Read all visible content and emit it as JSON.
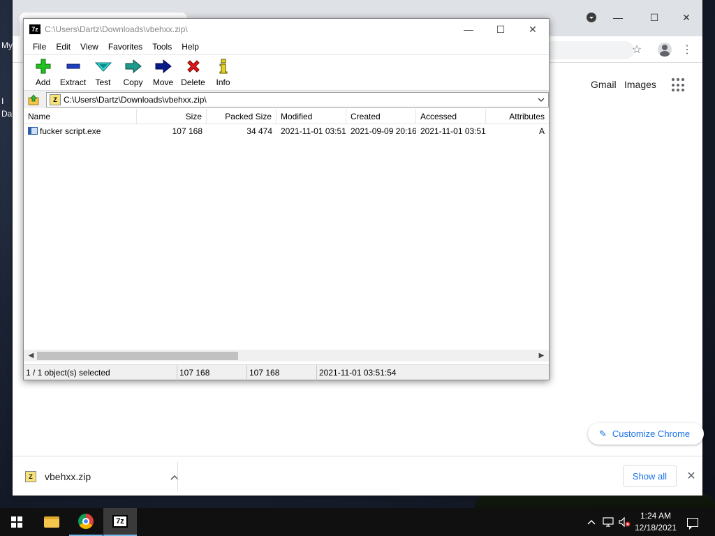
{
  "desktop": {
    "labels": [
      "My",
      "I",
      "Da"
    ]
  },
  "chrome": {
    "links": {
      "gmail": "Gmail",
      "images": "Images"
    },
    "customize_label": "Customize Chrome",
    "download": {
      "filename": "vbehxx.zip",
      "show_all": "Show all"
    },
    "icons": {
      "profile": "profile-avatar-icon",
      "bookmark": "star-icon",
      "menu": "kebab-menu-icon",
      "apps": "apps-grid-icon",
      "edit": "pencil-icon"
    }
  },
  "sevenzip": {
    "title": "C:\\Users\\Dartz\\Downloads\\vbehxx.zip\\",
    "app_icon_text": "7z",
    "menu": [
      "File",
      "Edit",
      "View",
      "Favorites",
      "Tools",
      "Help"
    ],
    "toolbar": [
      {
        "id": "add",
        "label": "Add",
        "icon": "plus-icon"
      },
      {
        "id": "extract",
        "label": "Extract",
        "icon": "minus-icon"
      },
      {
        "id": "test",
        "label": "Test",
        "icon": "check-arrow-icon"
      },
      {
        "id": "copy",
        "label": "Copy",
        "icon": "double-arrow-icon"
      },
      {
        "id": "move",
        "label": "Move",
        "icon": "arrow-right-icon"
      },
      {
        "id": "delete",
        "label": "Delete",
        "icon": "x-icon"
      },
      {
        "id": "info",
        "label": "Info",
        "icon": "info-icon"
      }
    ],
    "address": "C:\\Users\\Dartz\\Downloads\\vbehxx.zip\\",
    "columns": [
      "Name",
      "Size",
      "Packed Size",
      "Modified",
      "Created",
      "Accessed",
      "Attributes"
    ],
    "rows": [
      {
        "name": "fucker script.exe",
        "size": "107 168",
        "packed": "34 474",
        "modified": "2021-11-01 03:51",
        "created": "2021-09-09 20:16",
        "accessed": "2021-11-01 03:51",
        "attributes": "A"
      }
    ],
    "status": {
      "selection": "1 / 1 object(s) selected",
      "size": "107 168",
      "packed": "107 168",
      "modified": "2021-11-01 03:51:54"
    }
  },
  "taskbar": {
    "time": "1:24 AM",
    "date": "12/18/2021",
    "apps": [
      "start",
      "file-explorer",
      "chrome",
      "7-zip"
    ]
  }
}
